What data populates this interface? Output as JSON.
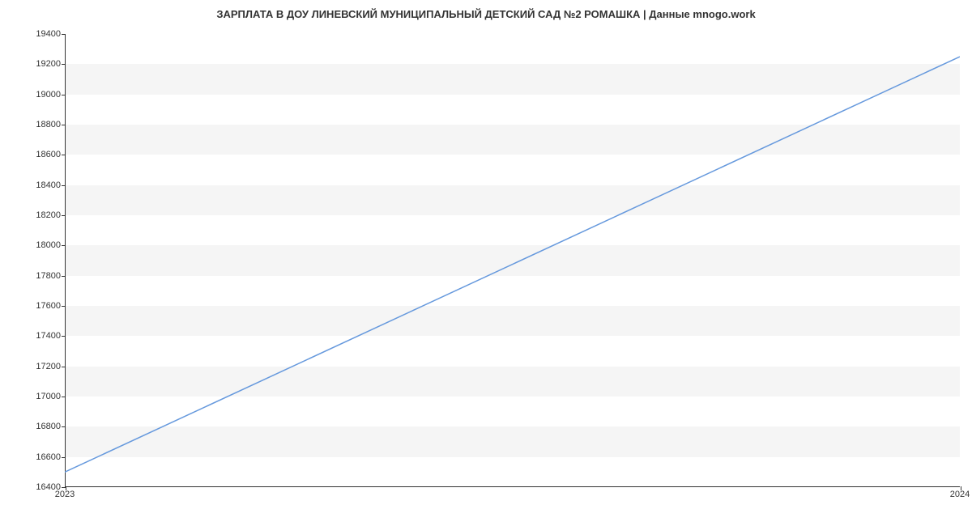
{
  "chart_data": {
    "type": "line",
    "title": "ЗАРПЛАТА В ДОУ ЛИНЕВСКИЙ МУНИЦИПАЛЬНЫЙ ДЕТСКИЙ САД №2 РОМАШКА | Данные mnogo.work",
    "x": [
      "2023",
      "2024"
    ],
    "values": [
      16500,
      19250
    ],
    "xlabel": "",
    "ylabel": "",
    "xlim": [
      "2023",
      "2024"
    ],
    "ylim": [
      16400,
      19400
    ],
    "y_ticks": [
      16400,
      16600,
      16800,
      17000,
      17200,
      17400,
      17600,
      17800,
      18000,
      18200,
      18400,
      18600,
      18800,
      19000,
      19200,
      19400
    ],
    "x_ticks": [
      "2023",
      "2024"
    ],
    "line_color": "#6699dd",
    "grid_band_color": "#f5f5f5"
  }
}
